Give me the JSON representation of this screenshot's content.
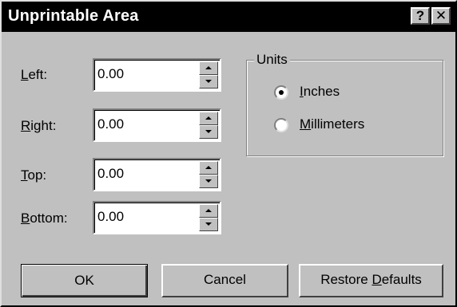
{
  "window": {
    "title": "Unprintable Area",
    "help_glyph": "?",
    "close_glyph": "✕"
  },
  "fields": [
    {
      "label_mnemonic": "L",
      "label_rest": "eft:",
      "value": "0.00"
    },
    {
      "label_mnemonic": "R",
      "label_rest": "ight:",
      "value": "0.00"
    },
    {
      "label_mnemonic": "T",
      "label_rest": "op:",
      "value": "0.00"
    },
    {
      "label_mnemonic": "B",
      "label_rest": "ottom:",
      "value": "0.00"
    }
  ],
  "units": {
    "group_label": "Units",
    "options": [
      {
        "mnemonic": "I",
        "rest": "nches",
        "selected": true
      },
      {
        "mnemonic": "M",
        "rest": "illimeters",
        "selected": false
      }
    ]
  },
  "buttons": {
    "ok": "OK",
    "cancel": "Cancel",
    "restore_prefix": "Restore ",
    "restore_mnemonic": "D",
    "restore_rest": "efaults"
  },
  "icons": {
    "help": "question-mark-icon",
    "close": "close-icon",
    "spin_up": "up-arrow-icon",
    "spin_down": "down-arrow-icon"
  }
}
